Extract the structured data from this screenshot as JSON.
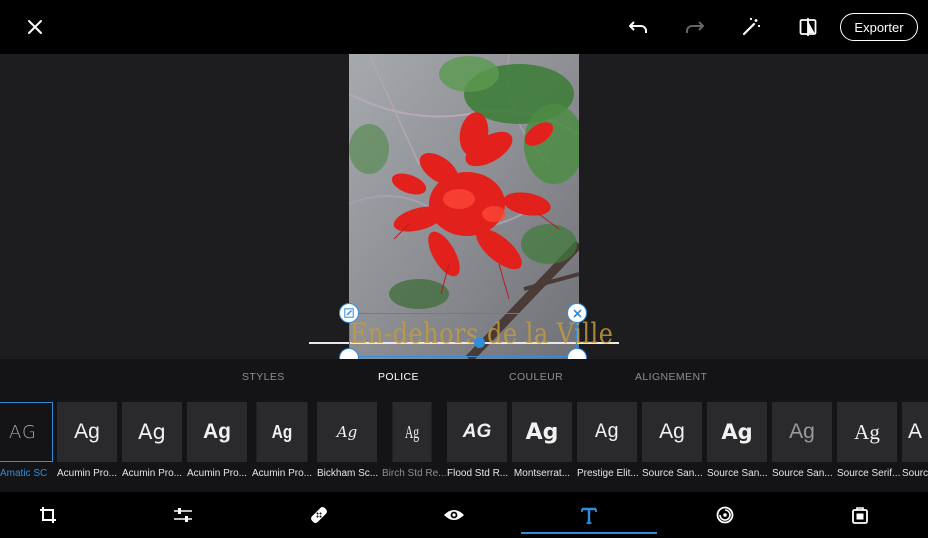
{
  "topbar": {
    "icons": [
      "close-icon",
      "undo-icon",
      "redo-icon",
      "magic-wand-icon",
      "compare-icon"
    ],
    "export_label": "Exporter"
  },
  "canvas": {
    "overlay_text": "En-dehors de la Ville",
    "overlay_text_color": "#c49a3e",
    "handle_icons": [
      "edit-icon",
      "delete-icon",
      "duplicate-icon",
      "resize-icon"
    ]
  },
  "tabs": [
    {
      "label": "STYLES",
      "active": false
    },
    {
      "label": "POLICE",
      "active": true
    },
    {
      "label": "COULEUR",
      "active": false
    },
    {
      "label": "ALIGNEMENT",
      "active": false
    }
  ],
  "fonts": [
    {
      "sample": "AG",
      "label": "Amatic SC",
      "selected": true
    },
    {
      "sample": "Ag",
      "label": "Acumin Pro..."
    },
    {
      "sample": "Ag",
      "label": "Acumin Pro..."
    },
    {
      "sample": "Ag",
      "label": "Acumin Pro..."
    },
    {
      "sample": "Ag",
      "label": "Acumin Pro..."
    },
    {
      "sample": "Ag",
      "label": "Bickham Sc..."
    },
    {
      "sample": "Ag",
      "label": "Birch Std Re...",
      "dim": true
    },
    {
      "sample": "AG",
      "label": "Flood Std R..."
    },
    {
      "sample": "Ag",
      "label": "Montserrat..."
    },
    {
      "sample": "Ag",
      "label": "Prestige Elit..."
    },
    {
      "sample": "Ag",
      "label": "Source San..."
    },
    {
      "sample": "Ag",
      "label": "Source San..."
    },
    {
      "sample": "Ag",
      "label": "Source San..."
    },
    {
      "sample": "Ag",
      "label": "Source Serif..."
    },
    {
      "sample": "A",
      "label": "Sourc"
    }
  ],
  "bottombar": {
    "tools": [
      "crop-icon",
      "adjust-sliders-icon",
      "healing-icon",
      "eye-icon",
      "text-icon",
      "sticker-icon",
      "frame-icon"
    ],
    "active_tool": "text-icon"
  },
  "colors": {
    "accent": "#2f8ddc",
    "bar": "#000000",
    "panel": "#141416",
    "tile": "#2a2a2d"
  }
}
